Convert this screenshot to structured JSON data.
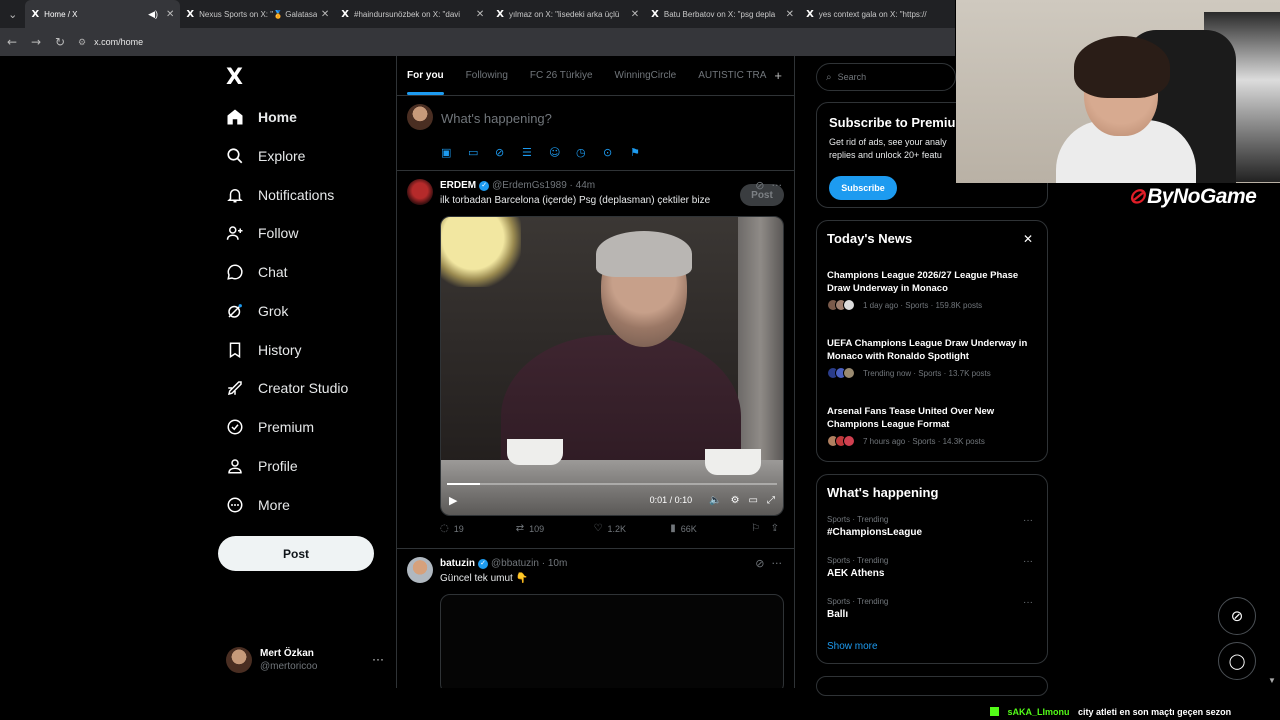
{
  "browser": {
    "tabs": [
      {
        "title": "Home / X",
        "active": true,
        "audio": true
      },
      {
        "title": "Nexus Sports on X: \"🏅 Galatasa",
        "active": false
      },
      {
        "title": "#haindursunözbek on X: \"davi",
        "active": false
      },
      {
        "title": "yılmaz on X: \"lisedeki arka üçlü",
        "active": false
      },
      {
        "title": "Batu Berbatov on X: \"psg depla",
        "active": false
      },
      {
        "title": "yes context gala on X: \"https://",
        "active": false
      }
    ],
    "url": "x.com/home"
  },
  "sidebar": {
    "logo": "X",
    "items": [
      {
        "label": "Home",
        "icon": "home-icon",
        "active": true
      },
      {
        "label": "Explore",
        "icon": "search-icon"
      },
      {
        "label": "Notifications",
        "icon": "bell-icon"
      },
      {
        "label": "Follow",
        "icon": "person-plus-icon"
      },
      {
        "label": "Chat",
        "icon": "chat-bubble-icon"
      },
      {
        "label": "Grok",
        "icon": "grok-icon"
      },
      {
        "label": "History",
        "icon": "bookmark-icon"
      },
      {
        "label": "Creator Studio",
        "icon": "rocket-icon"
      },
      {
        "label": "Premium",
        "icon": "premium-check-icon"
      },
      {
        "label": "Profile",
        "icon": "person-icon"
      },
      {
        "label": "More",
        "icon": "more-circle-icon"
      }
    ],
    "post_label": "Post",
    "account": {
      "name": "Mert Özkan",
      "handle": "@mertoricoo",
      "more": "···"
    }
  },
  "feed": {
    "tabs": [
      "For you",
      "Following",
      "FC 26 Türkiye",
      "WinningCircle",
      "AUTISTIC TRA"
    ],
    "add_tab": "+",
    "compose": {
      "placeholder": "What's happening?",
      "post_label": "Post"
    },
    "tweets": [
      {
        "name": "ERDEM",
        "handle": "@ErdemGs1989",
        "time": "44m",
        "text": "ilk torbadan Barcelona (içerde) Psg (deplasman) çektiler bize",
        "video": {
          "time": "0:01 / 0:10",
          "progress": 0.1
        },
        "stats": {
          "replies": "19",
          "reposts": "109",
          "likes": "1.2K",
          "views": "66K"
        }
      },
      {
        "name": "batuzin",
        "handle": "@bbatuzin",
        "time": "10m",
        "text": "Güncel tek umut 👇"
      }
    ]
  },
  "right": {
    "search_placeholder": "Search",
    "premium": {
      "title": "Subscribe to Premium",
      "line1": "Get rid of ads, see your analy",
      "line2": "replies and unlock 20+ featu",
      "button": "Subscribe"
    },
    "news": {
      "title": "Today's News",
      "close": "✕",
      "items": [
        {
          "title": "Champions League 2026/27 League Phase Draw Underway in Monaco",
          "meta": "1 day ago · Sports · 159.8K posts"
        },
        {
          "title": "UEFA Champions League Draw Underway in Monaco with Ronaldo Spotlight",
          "meta": "Trending now · Sports · 13.7K posts"
        },
        {
          "title": "Arsenal Fans Tease United Over New Champions League Format",
          "meta": "7 hours ago · Sports · 14.3K posts"
        }
      ]
    },
    "happening": {
      "title": "What's happening",
      "trends": [
        {
          "context": "Sports · Trending",
          "name": "#ChampionsLeague"
        },
        {
          "context": "Sports · Trending",
          "name": "AEK Athens"
        },
        {
          "context": "Sports · Trending",
          "name": "Ballı"
        }
      ],
      "show_more": "Show more"
    }
  },
  "overlay": {
    "brand": "ByNoGame",
    "chat_user": "sAKA_LImonu",
    "chat_message": "city atleti en son maçtı geçen sezon"
  },
  "colors": {
    "accent": "#1d9bf0",
    "background": "#000000",
    "border": "#2f3336",
    "kick_green": "#53fc18"
  }
}
